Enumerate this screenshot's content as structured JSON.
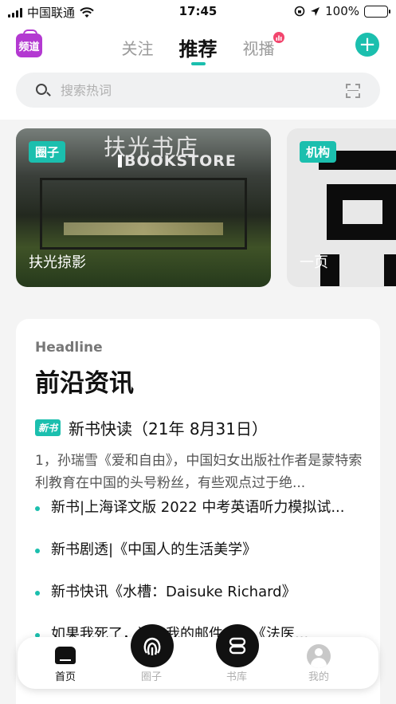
{
  "status_bar": {
    "carrier": "中国联通",
    "time": "17:45",
    "battery": "100%"
  },
  "header": {
    "channel_label": "频道",
    "tabs": [
      {
        "label": "关注",
        "active": false
      },
      {
        "label": "推荐",
        "active": true
      },
      {
        "label": "视播",
        "active": false,
        "badge_icon": "chart-badge-icon"
      }
    ],
    "add_icon": "plus-icon"
  },
  "search": {
    "placeholder": "搜索热词",
    "icon": "search-icon",
    "scan_icon": "scan-icon"
  },
  "cards": [
    {
      "tag": "圈子",
      "title": "扶光掠影",
      "sign_text": "扶光书店",
      "sign_subtext": "BOOKSTORE"
    },
    {
      "tag": "机构",
      "title": "一页"
    }
  ],
  "headline_panel": {
    "eyebrow": "Headline",
    "title": "前沿资讯",
    "feature_badge": "新书",
    "feature_title": "新书快读（21年 8月31日）",
    "excerpt": "1，孙瑞雪《爱和自由》，中国妇女出版社作者是蒙特索利教育在中国的头号粉丝，有些观点过于绝...",
    "items": [
      "新书|上海译文版 2022 中考英语听力模拟试...",
      "新书剧透|《中国人的生活美学》",
      "新书快讯《水槽：Daisuke Richard》",
      "如果我死了，请查我的邮件——《法医..."
    ]
  },
  "tabbar": {
    "items": [
      {
        "label": "首页",
        "icon": "home-icon",
        "active": true
      },
      {
        "label": "圈子",
        "icon": "circle-icon",
        "active": false
      },
      {
        "label": "书库",
        "icon": "library-icon",
        "active": false
      },
      {
        "label": "我的",
        "icon": "profile-icon",
        "active": false
      }
    ]
  },
  "colors": {
    "accent": "#1bbfae",
    "channel": "#b339d1",
    "badge": "#f2456d"
  }
}
